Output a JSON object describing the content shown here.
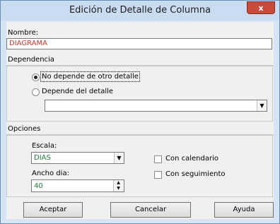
{
  "window": {
    "title": "Edición de Detalle de Columna",
    "close_label": "x"
  },
  "nombre": {
    "label": "Nombre:",
    "value": "DIAGRAMA"
  },
  "dependencia": {
    "group_label": "Dependencia",
    "radio_no_depende": "No depende de otro detalle",
    "radio_depende": "Depende del detalle",
    "selected": "no_depende",
    "detalle_value": ""
  },
  "opciones": {
    "group_label": "Opciones",
    "escala_label": "Escala:",
    "escala_value": "DIAS",
    "ancho_label": "Ancho dia:",
    "ancho_value": "40",
    "con_calendario": "Con calendario",
    "con_seguimiento": "Con seguimiento",
    "con_calendario_checked": false,
    "con_seguimiento_checked": false
  },
  "buttons": {
    "aceptar": "Aceptar",
    "cancelar": "Cancelar",
    "ayuda": "Ayuda"
  }
}
